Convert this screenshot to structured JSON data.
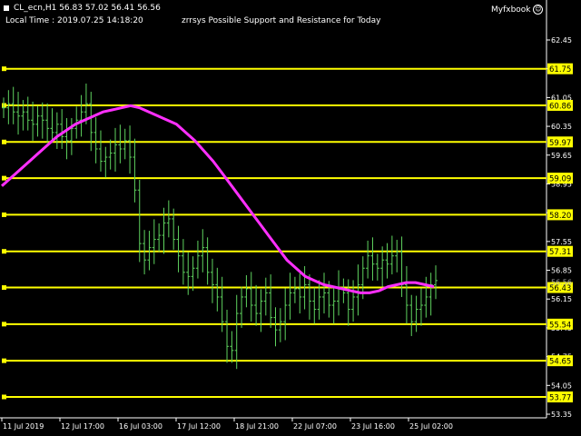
{
  "header": {
    "symbol_ohlc": "CL_ecn,H1  56.83 57.02 56.41 56.56",
    "local_time": "Local Time : 2019.07.25 14:18:20",
    "indicator_title": "zrrsys Possible Support and Resistance for Today",
    "brand": "Myfxbook"
  },
  "colors": {
    "background": "#000000",
    "candles": "#5fd35f",
    "moving_average": "#ff2fff",
    "levels": "#ffff00",
    "axis": "#ffffff"
  },
  "chart_data": {
    "type": "ohlc",
    "y_ticks": [
      "62.45",
      "61.75",
      "61.05",
      "60.35",
      "59.65",
      "58.95",
      "58.25",
      "57.55",
      "56.85",
      "56.15",
      "55.45",
      "54.75",
      "54.05",
      "53.35"
    ],
    "x_ticks": [
      "11 Jul 2019",
      "12 Jul 17:00",
      "16 Jul 03:00",
      "17 Jul 12:00",
      "18 Jul 21:00",
      "22 Jul 07:00",
      "23 Jul 16:00",
      "25 Jul 02:00"
    ],
    "ylim": [
      53.35,
      62.65
    ],
    "levels": [
      "61.75",
      "60.86",
      "59.97",
      "59.09",
      "58.20",
      "57.31",
      "56.43",
      "55.54",
      "54.65",
      "53.77"
    ],
    "current_price_label": "56.56",
    "series_close": [
      60.8,
      60.9,
      60.7,
      60.6,
      60.7,
      60.5,
      60.4,
      60.6,
      60.5,
      60.3,
      60.2,
      60.4,
      60.1,
      60.0,
      60.3,
      60.5,
      60.7,
      60.9,
      60.2,
      59.8,
      59.5,
      59.6,
      59.7,
      59.9,
      59.8,
      60.0,
      59.6,
      58.8,
      57.5,
      57.1,
      57.4,
      57.6,
      57.7,
      58.0,
      58.1,
      57.6,
      57.2,
      56.8,
      56.7,
      56.9,
      57.2,
      57.4,
      56.8,
      56.5,
      56.2,
      55.6,
      55.0,
      54.9,
      55.8,
      56.2,
      56.4,
      56.0,
      55.8,
      56.1,
      56.3,
      55.7,
      55.4,
      55.6,
      56.0,
      56.3,
      56.4,
      56.2,
      56.5,
      56.1,
      55.9,
      56.2,
      56.3,
      56.0,
      56.1,
      56.4,
      56.3,
      55.9,
      56.2,
      56.5,
      56.9,
      57.2,
      57.0,
      56.9,
      57.1,
      57.0,
      57.2,
      57.3,
      56.5,
      56.0,
      55.6,
      55.9,
      56.0,
      56.2,
      56.5,
      56.6
    ],
    "series_ma": [
      58.9,
      59.1,
      59.3,
      59.5,
      59.7,
      59.9,
      60.1,
      60.25,
      60.4,
      60.5,
      60.6,
      60.7,
      60.75,
      60.8,
      60.85,
      60.8,
      60.7,
      60.6,
      60.5,
      60.4,
      60.2,
      60.0,
      59.75,
      59.5,
      59.2,
      58.9,
      58.6,
      58.3,
      58.0,
      57.7,
      57.4,
      57.1,
      56.9,
      56.7,
      56.6,
      56.5,
      56.45,
      56.4,
      56.35,
      56.3,
      56.3,
      56.35,
      56.45,
      56.5,
      56.55,
      56.55,
      56.5,
      56.45
    ]
  }
}
